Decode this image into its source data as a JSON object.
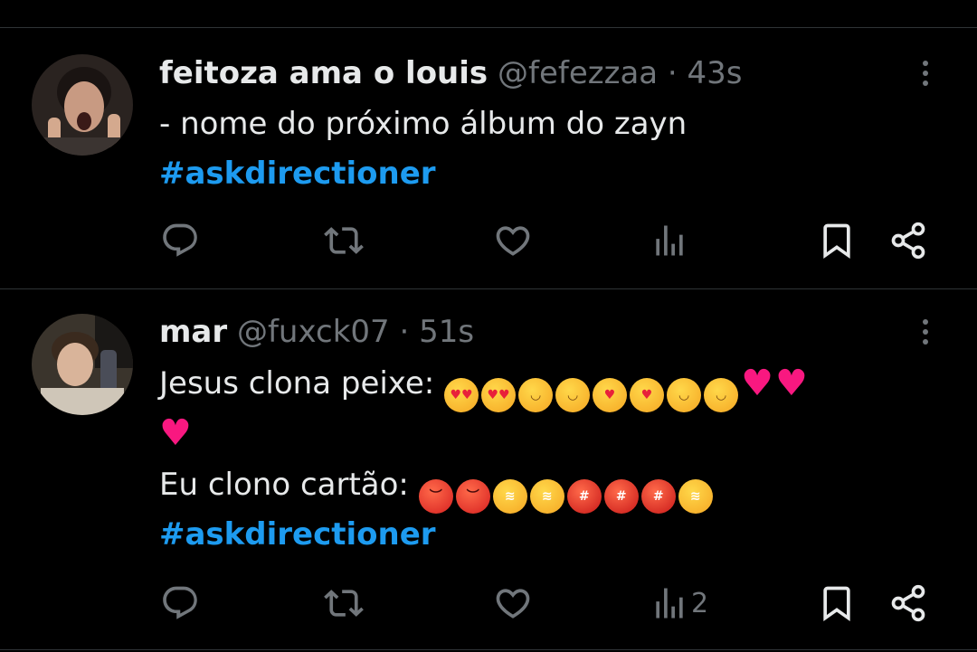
{
  "tweets": [
    {
      "display_name": "feitoza ama o louis",
      "handle": "@fefezzaa",
      "separator": "·",
      "time": "43s",
      "lines": [
        "- nome do próximo álbum do zayn"
      ],
      "hashtag": "#askdirectioner",
      "stats": {
        "replies": "",
        "reposts": "",
        "likes": "",
        "views": ""
      }
    },
    {
      "display_name": "mar",
      "handle": "@fuxck07",
      "separator": "·",
      "time": "51s",
      "line1_text": "Jesus clona peixe:",
      "line1_emojis": [
        "heart-eyes",
        "heart-eyes",
        "smiling-hearts",
        "smiling-hearts",
        "kissing-heart",
        "kissing-heart",
        "relaxed",
        "relaxed",
        "red-heart",
        "red-heart"
      ],
      "line2_emojis": [
        "red-heart"
      ],
      "line3_text": "Eu clono cartão:",
      "line3_emojis": [
        "pouting-face",
        "pouting-face",
        "triumph-face",
        "triumph-face",
        "cursing-face",
        "cursing-face",
        "cursing-face",
        "triumph-face"
      ],
      "hashtag": "#askdirectioner",
      "stats": {
        "replies": "",
        "reposts": "",
        "likes": "",
        "views": "2"
      }
    }
  ],
  "colors": {
    "background": "#000000",
    "text": "#e7e9ea",
    "muted": "#71767b",
    "link": "#1d9bf0",
    "divider": "#2f3336",
    "heart": "#f91880"
  },
  "icons": [
    "reply-icon",
    "repost-icon",
    "like-icon",
    "views-icon",
    "bookmark-icon",
    "share-icon",
    "more-icon"
  ]
}
